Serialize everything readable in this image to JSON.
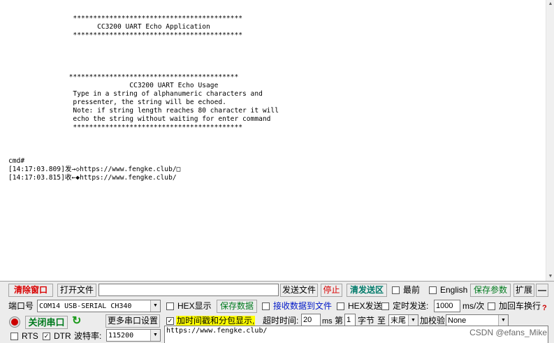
{
  "terminal": {
    "lines": [
      "                ******************************************",
      "                      CC3200 UART Echo Application",
      "                ******************************************",
      "",
      "",
      "",
      "",
      "               ******************************************",
      "                              CC3200 UART Echo Usage",
      "                Type in a string of alphanumeric characters and",
      "                pressenter, the string will be echoed.",
      "                Note: if string length reaches 80 character it will",
      "                echo the string without waiting for enter command",
      "                ******************************************",
      "",
      "",
      "",
      "cmd#",
      "[14:17:03.809]发→◇https://www.fengke.club/□",
      "[14:17:03.815]收←◆https://www.fengke.club/"
    ]
  },
  "toolbar": {
    "clear_window": "清除窗口",
    "open_file": "打开文件",
    "file_path": "",
    "send_file": "发送文件",
    "stop": "停止",
    "clear_send": "清发送区",
    "topmost": "最前",
    "english": "English",
    "save_params": "保存参数",
    "expand": "扩展",
    "collapse": "—"
  },
  "row2": {
    "port_label": "端口号",
    "port_value": "COM14 USB-SERIAL CH340",
    "hex_display": "HEX显示",
    "save_data": "保存数据",
    "recv_to_file": "接收数据到文件",
    "hex_send": "HEX发送",
    "timed_send": "定时发送:",
    "interval": "1000",
    "interval_unit": "ms/次",
    "add_crlf": "加回车换行",
    "help_mark": "?"
  },
  "row3": {
    "close_port": "关闭串口",
    "more_settings": "更多串口设置",
    "timestamp_display": "加时间戳和分包显示,",
    "timeout_label": "超时时间:",
    "timeout_value": "20",
    "timeout_unit": "ms",
    "byte_prefix": "第",
    "byte_index": "1",
    "byte_suffix": "字节",
    "to_label": "至",
    "to_value": "末尾",
    "checksum_label": "加校验",
    "checksum_value": "None"
  },
  "row4": {
    "rts": "RTS",
    "dtr": "DTR",
    "baud_label": "波特率:",
    "baud_value": "115200",
    "send_text": "https://www.fengke.club/"
  },
  "watermark": "CSDN @efans_Mike"
}
